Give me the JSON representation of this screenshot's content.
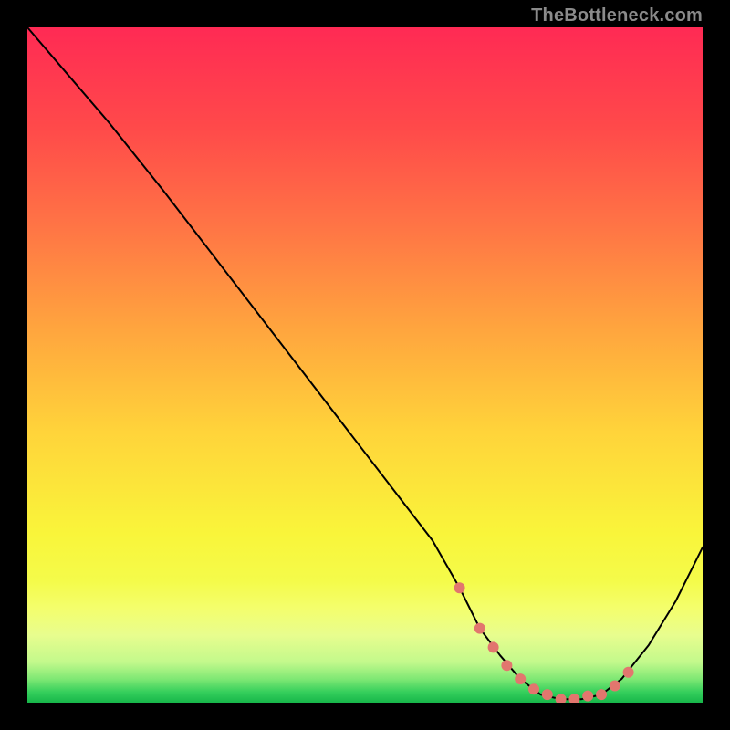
{
  "watermark": "TheBottleneck.com",
  "chart_data": {
    "type": "line",
    "title": "",
    "xlabel": "",
    "ylabel": "",
    "xlim": [
      0,
      100
    ],
    "ylim": [
      0,
      100
    ],
    "series": [
      {
        "name": "curve",
        "x": [
          0,
          6,
          12,
          20,
          30,
          40,
          50,
          60,
          64,
          67,
          70,
          73,
          76,
          79,
          82,
          85,
          88,
          92,
          96,
          100
        ],
        "values": [
          100,
          93,
          86,
          76,
          63,
          50,
          37,
          24,
          17,
          11,
          7,
          3.5,
          1.2,
          0.5,
          0.5,
          1.2,
          3.5,
          8.5,
          15,
          23
        ],
        "stroke": "#000000",
        "stroke_width": 2
      }
    ],
    "markers": {
      "name": "highlight-dots",
      "x": [
        64,
        67,
        69,
        71,
        73,
        75,
        77,
        79,
        81,
        83,
        85,
        87,
        89
      ],
      "values": [
        17,
        11,
        8.2,
        5.5,
        3.5,
        2.0,
        1.2,
        0.5,
        0.5,
        1.0,
        1.2,
        2.5,
        4.5
      ],
      "color": "#E2766E",
      "radius": 6
    },
    "background_gradient": {
      "stops": [
        {
          "offset": 0,
          "color": "#FF2A54"
        },
        {
          "offset": 0.15,
          "color": "#FF4A4A"
        },
        {
          "offset": 0.3,
          "color": "#FF7645"
        },
        {
          "offset": 0.45,
          "color": "#FFA63E"
        },
        {
          "offset": 0.6,
          "color": "#FFD43A"
        },
        {
          "offset": 0.75,
          "color": "#F9F53A"
        },
        {
          "offset": 0.82,
          "color": "#F4FB4A"
        },
        {
          "offset": 0.86,
          "color": "#F4FE6C"
        },
        {
          "offset": 0.9,
          "color": "#E8FD8E"
        },
        {
          "offset": 0.94,
          "color": "#C3F98C"
        },
        {
          "offset": 0.965,
          "color": "#7FE874"
        },
        {
          "offset": 0.985,
          "color": "#33CE5B"
        },
        {
          "offset": 1.0,
          "color": "#17B64A"
        }
      ]
    }
  }
}
